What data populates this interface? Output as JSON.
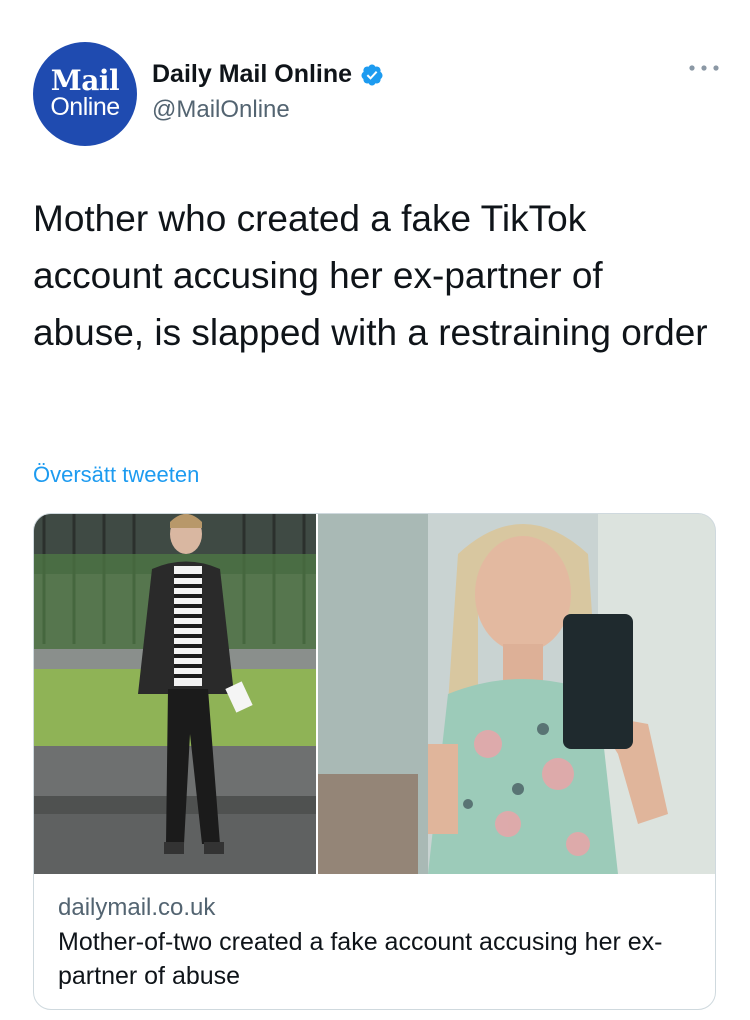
{
  "account": {
    "avatar_logo_top": "Mail",
    "avatar_logo_bottom": "Online",
    "display_name": "Daily Mail Online",
    "handle": "@MailOnline",
    "brand_color": "#1f4bb0",
    "verified_color": "#1d9bf0",
    "verified_icon": "verified-badge-icon",
    "more_icon": "more-options-icon"
  },
  "tweet": {
    "text": "Mother who created a fake TikTok account accusing her ex-partner of abuse, is slapped with a restraining order",
    "translate_label": "Översätt tweeten"
  },
  "link_card": {
    "domain": "dailymail.co.uk",
    "title": "Mother-of-two created a fake account accusing her ex-partner of abuse"
  }
}
